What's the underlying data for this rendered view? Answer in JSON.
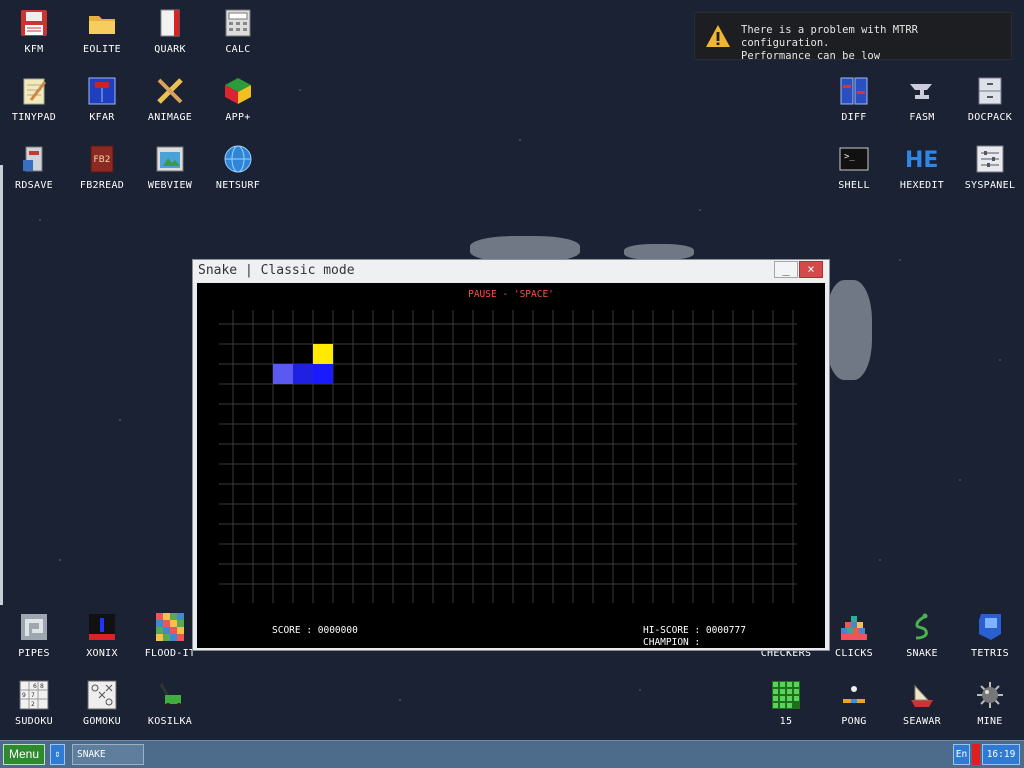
{
  "notification": {
    "line1": "There is a problem with MTRR configuration.",
    "line2": "Performance can be low",
    "icon": "warning-icon"
  },
  "desktop_icons": [
    {
      "id": "kfm",
      "label": "KFM",
      "icon": "floppy-icon"
    },
    {
      "id": "eolite",
      "label": "EOLITE",
      "icon": "folder-icon"
    },
    {
      "id": "quark",
      "label": "QUARK",
      "icon": "book-icon"
    },
    {
      "id": "calc",
      "label": "CALC",
      "icon": "calculator-icon"
    },
    {
      "id": "tinypad",
      "label": "TINYPAD",
      "icon": "notepad-icon"
    },
    {
      "id": "kfar",
      "label": "KFAR",
      "icon": "kfar-icon"
    },
    {
      "id": "animage",
      "label": "ANIMAGE",
      "icon": "pencil-ruler-icon"
    },
    {
      "id": "app",
      "label": "APP+",
      "icon": "rubik-cube-icon"
    },
    {
      "id": "rdsave",
      "label": "RDSAVE",
      "icon": "rdsave-icon"
    },
    {
      "id": "fb2read",
      "label": "FB2READ",
      "icon": "fb2-book-icon"
    },
    {
      "id": "webview",
      "label": "WEBVIEW",
      "icon": "map-window-icon"
    },
    {
      "id": "netsurf",
      "label": "NETSURF",
      "icon": "globe-icon"
    },
    {
      "id": "diff",
      "label": "DIFF",
      "icon": "diff-icon"
    },
    {
      "id": "fasm",
      "label": "FASM",
      "icon": "anvil-icon"
    },
    {
      "id": "docpack",
      "label": "DOCPACK",
      "icon": "cabinet-icon"
    },
    {
      "id": "shell",
      "label": "SHELL",
      "icon": "terminal-icon"
    },
    {
      "id": "hexedit",
      "label": "HEXEDIT",
      "icon": "hex-icon"
    },
    {
      "id": "syspanel",
      "label": "SYSPANEL",
      "icon": "sliders-icon"
    },
    {
      "id": "pipes",
      "label": "PIPES",
      "icon": "pipes-icon"
    },
    {
      "id": "xonix",
      "label": "XONIX",
      "icon": "xonix-icon"
    },
    {
      "id": "floodit",
      "label": "FLOOD-IT",
      "icon": "color-grid-icon"
    },
    {
      "id": "checkers",
      "label": "CHECKERS",
      "icon": "checkers-icon"
    },
    {
      "id": "clicks",
      "label": "CLICKS",
      "icon": "blocks-icon"
    },
    {
      "id": "snake",
      "label": "SNAKE",
      "icon": "snake-icon"
    },
    {
      "id": "tetris",
      "label": "TETRIS",
      "icon": "tetris-icon"
    },
    {
      "id": "sudoku",
      "label": "SUDOKU",
      "icon": "sudoku-icon"
    },
    {
      "id": "gomoku",
      "label": "GOMOKU",
      "icon": "gomoku-icon"
    },
    {
      "id": "kosilka",
      "label": "KOSILKA",
      "icon": "lawnmower-icon"
    },
    {
      "id": "fifteen",
      "label": "15",
      "icon": "fifteen-grid-icon"
    },
    {
      "id": "pong",
      "label": "PONG",
      "icon": "pong-icon"
    },
    {
      "id": "seawar",
      "label": "SEAWAR",
      "icon": "ship-icon"
    },
    {
      "id": "mine",
      "label": "MINE",
      "icon": "mine-icon"
    }
  ],
  "window": {
    "title": "Snake | Classic mode",
    "minimize_label": "_",
    "close_label": "×",
    "pause_text": "PAUSE - 'SPACE'",
    "score_text": "SCORE : 0000000",
    "hiscore_text": "HI-SCORE : 0000777",
    "champion_text": "CHAMPION :"
  },
  "game": {
    "cols": 28,
    "rows": 15,
    "food": {
      "col": 4,
      "row": 1
    },
    "snake": [
      {
        "col": 2,
        "row": 2,
        "part": "tail"
      },
      {
        "col": 3,
        "row": 2,
        "part": "body"
      },
      {
        "col": 4,
        "row": 2,
        "part": "head"
      }
    ],
    "colors": {
      "food": "#ffea00",
      "head": "#1a1aff",
      "body": "#2020e0",
      "tail": "#5a5af2",
      "grid": "#3a3a3a"
    }
  },
  "taskbar": {
    "menu_label": "Menu",
    "switch_label": "⇕",
    "task_label": "SNAKE",
    "lang_label": "En",
    "clock": "16:19"
  }
}
